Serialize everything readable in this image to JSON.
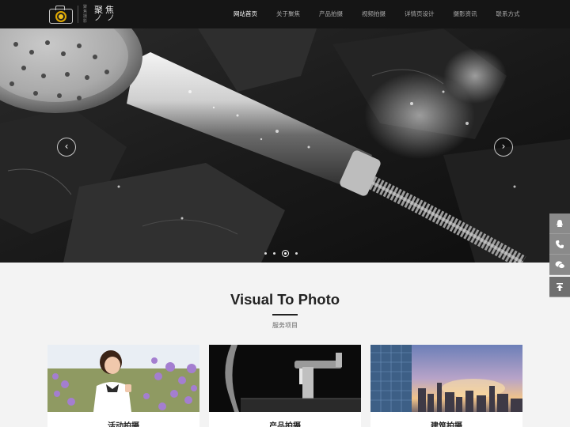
{
  "header": {
    "logo": {
      "name": "聚焦",
      "strokes": "ノノ",
      "vertical_text": "聚焦摄影"
    },
    "nav": [
      "网站首页",
      "关于聚焦",
      "产品拍摄",
      "视频拍摄",
      "详情页设计",
      "摄影资讯",
      "联系方式"
    ],
    "active_index": 0
  },
  "banner": {
    "slides": 4,
    "active_slide": 3,
    "prev": "‹",
    "next": "›"
  },
  "sidebar": {
    "icons": [
      "qq-icon",
      "phone-icon",
      "wechat-icon",
      "back-to-top-icon"
    ]
  },
  "services": {
    "title": "Visual To Photo",
    "subtitle": "服务项目",
    "cards": [
      {
        "label": "活动拍摄",
        "image": "girl-in-lavender-field"
      },
      {
        "label": "产品拍摄",
        "image": "faucet-product"
      },
      {
        "label": "建筑拍摄",
        "image": "city-skyline"
      }
    ]
  },
  "colors": {
    "header_bg": "#151515",
    "accent": "#f2c21b",
    "page_bg": "#f3f3f3"
  }
}
